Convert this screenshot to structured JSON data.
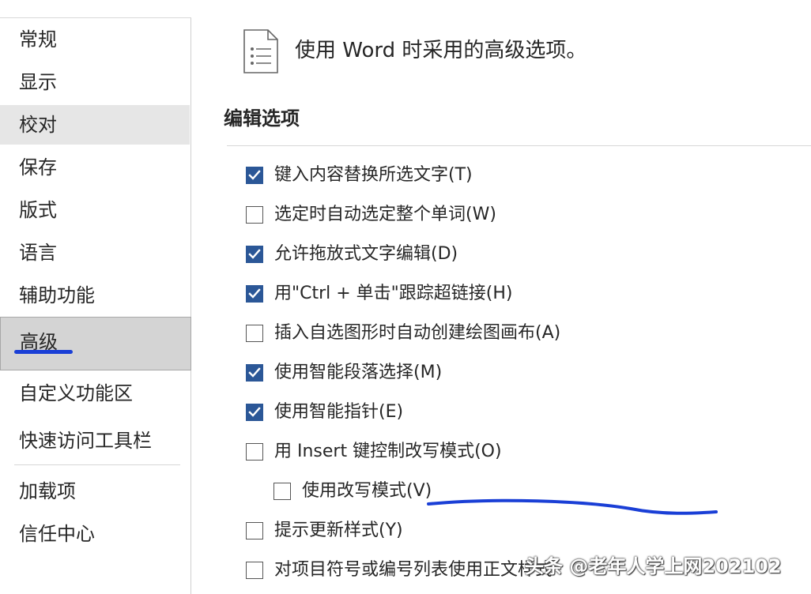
{
  "sidebar": {
    "items": [
      {
        "label": "常规"
      },
      {
        "label": "显示"
      },
      {
        "label": "校对"
      },
      {
        "label": "保存"
      },
      {
        "label": "版式"
      },
      {
        "label": "语言"
      },
      {
        "label": "辅助功能"
      },
      {
        "label": "高级"
      },
      {
        "label": "自定义功能区"
      },
      {
        "label": "快速访问工具栏"
      },
      {
        "label": "加载项"
      },
      {
        "label": "信任中心"
      }
    ],
    "selected": "高级",
    "hovered": "校对"
  },
  "header": {
    "icon": "document-options-icon",
    "title": "使用 Word 时采用的高级选项。"
  },
  "section": {
    "title": "编辑选项"
  },
  "options": [
    {
      "label": "键入内容替换所选文字(T)",
      "checked": true
    },
    {
      "label": "选定时自动选定整个单词(W)",
      "checked": false
    },
    {
      "label": "允许拖放式文字编辑(D)",
      "checked": true
    },
    {
      "label": "用\"Ctrl + 单击\"跟踪超链接(H)",
      "checked": true
    },
    {
      "label": "插入自选图形时自动创建绘图画布(A)",
      "checked": false
    },
    {
      "label": "使用智能段落选择(M)",
      "checked": true
    },
    {
      "label": "使用智能指针(E)",
      "checked": true
    },
    {
      "label": "用 Insert 键控制改写模式(O)",
      "checked": false
    },
    {
      "label": "使用改写模式(V)",
      "checked": false
    },
    {
      "label": "提示更新样式(Y)",
      "checked": false
    },
    {
      "label": "对项目符号或编号列表使用正文样式",
      "checked": false
    }
  ],
  "colors": {
    "checkbox_checked": "#2b5797",
    "annotation": "#1a3fd6",
    "selected_bg": "#d4d4d4"
  },
  "watermark": "头条 @老年人学上网202102"
}
